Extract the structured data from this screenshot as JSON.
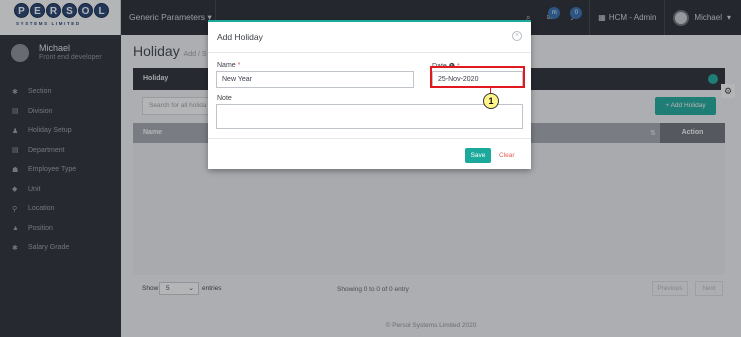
{
  "topbar": {
    "logo_text": "PERSOL",
    "logo_subtext": "SYSTEMS LIMITED",
    "module_select": "Generic Parameters",
    "chat_badge": "m",
    "notification_badge": "0",
    "hcm_label": "HCM - Admin",
    "user_name": "Michael"
  },
  "sidebar": {
    "profile_name": "Michael",
    "profile_role": "Front end developer",
    "items": [
      {
        "label": "Section",
        "icon": "pin-icon",
        "glyph": "✱"
      },
      {
        "label": "Division",
        "icon": "document-icon",
        "glyph": "▤"
      },
      {
        "label": "Holiday Setup",
        "icon": "person-icon",
        "glyph": "♟"
      },
      {
        "label": "Department",
        "icon": "document-icon",
        "glyph": "▤"
      },
      {
        "label": "Employee Type",
        "icon": "group-icon",
        "glyph": "☗"
      },
      {
        "label": "Unit",
        "icon": "diamond-icon",
        "glyph": "◆"
      },
      {
        "label": "Location",
        "icon": "map-pin-icon",
        "glyph": "⚲"
      },
      {
        "label": "Position",
        "icon": "graduation-icon",
        "glyph": "▲"
      },
      {
        "label": "Salary Grade",
        "icon": "pin-icon",
        "glyph": "✱"
      }
    ]
  },
  "main": {
    "title": "Holiday",
    "title_sub": "Add / S",
    "panel_title": "Holiday",
    "search_placeholder": "Search for all holida",
    "add_button": "+ Add Holiday",
    "columns": {
      "name": "Name",
      "sort": "⇅",
      "action": "Action"
    },
    "footer": {
      "show_label": "Show",
      "show_value": "5",
      "entries_label": "entries",
      "showing_text": "Showing 0 to 0 of 0 entry",
      "previous": "Previous",
      "next": "Next"
    },
    "copyright": "© Persol Systems Limited 2020"
  },
  "modal": {
    "title": "Add Holiday",
    "name_label": "Name",
    "name_required": "*",
    "name_value": "New Year",
    "date_label": "Date",
    "date_required": "*",
    "date_value": "25-Nov-2020",
    "note_label": "Note",
    "save_label": "Save",
    "clear_label": "Clear"
  },
  "annotation": {
    "callout_number": "1",
    "color": "#e0181f"
  },
  "colors": {
    "accent": "#1aa99a",
    "dark": "#22262c",
    "danger": "#e65c52"
  }
}
